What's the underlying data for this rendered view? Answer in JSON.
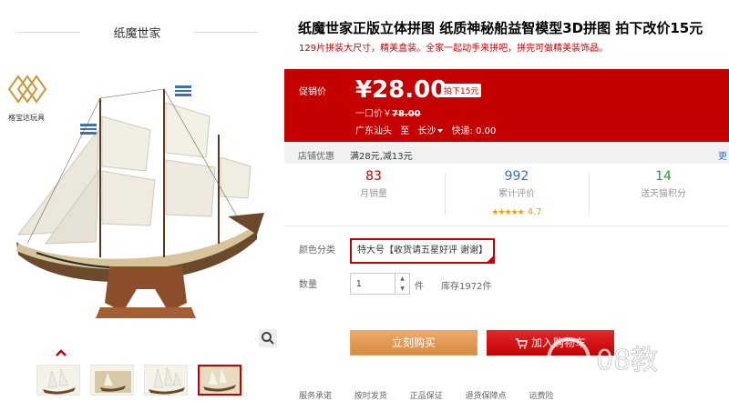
{
  "shop": {
    "name": "纸魔世家",
    "brand_name": "格宝达玩具"
  },
  "product": {
    "title": "纸魔世家正版立体拼图  纸质神秘船益智模型3D拼图  拍下改价15元",
    "subtitle": "129片拼装大尺寸，精美盒装。全家一起动手来拼吧，拼完可做精美装饰品。"
  },
  "promo": {
    "label": "促销价",
    "price": "¥28.00",
    "badge": "拍下15元",
    "orig_label": "一口价￥",
    "orig_price": "78.00",
    "ship_from": "广东汕头",
    "ship_to_word": "至",
    "ship_to": "长沙",
    "delivery": "快递: 0.00"
  },
  "shop_discount": {
    "label": "店铺优惠",
    "value": "满28元,减13元",
    "more": "更"
  },
  "stats": {
    "sales": {
      "num": "83",
      "label": "月销量"
    },
    "reviews": {
      "num": "992",
      "label": "累计评价",
      "rating": "4.7",
      "stars": 5
    },
    "points": {
      "num": "14",
      "label": "送天猫积分"
    }
  },
  "options": {
    "color_label": "颜色分类",
    "color_value": "特大号【收货请五星好评 谢谢】",
    "qty_label": "数量",
    "qty_value": "1",
    "qty_unit": "件",
    "stock": "库存1972件"
  },
  "buttons": {
    "buy": "立刻购买",
    "cart": "加入购物车"
  },
  "bottom": {
    "items": [
      "服务承诺",
      "按时发货",
      "正品保证",
      "退货保障点",
      "运费险"
    ]
  },
  "colors": {
    "accent": "#c40000",
    "link": "#3c6fb6",
    "buy_button": "#e0954e"
  },
  "icons": [
    "brand-logo-icon",
    "zoom-icon",
    "chevron-up-icon",
    "cart-icon",
    "star-icon",
    "stepper-up-icon",
    "stepper-down-icon"
  ]
}
